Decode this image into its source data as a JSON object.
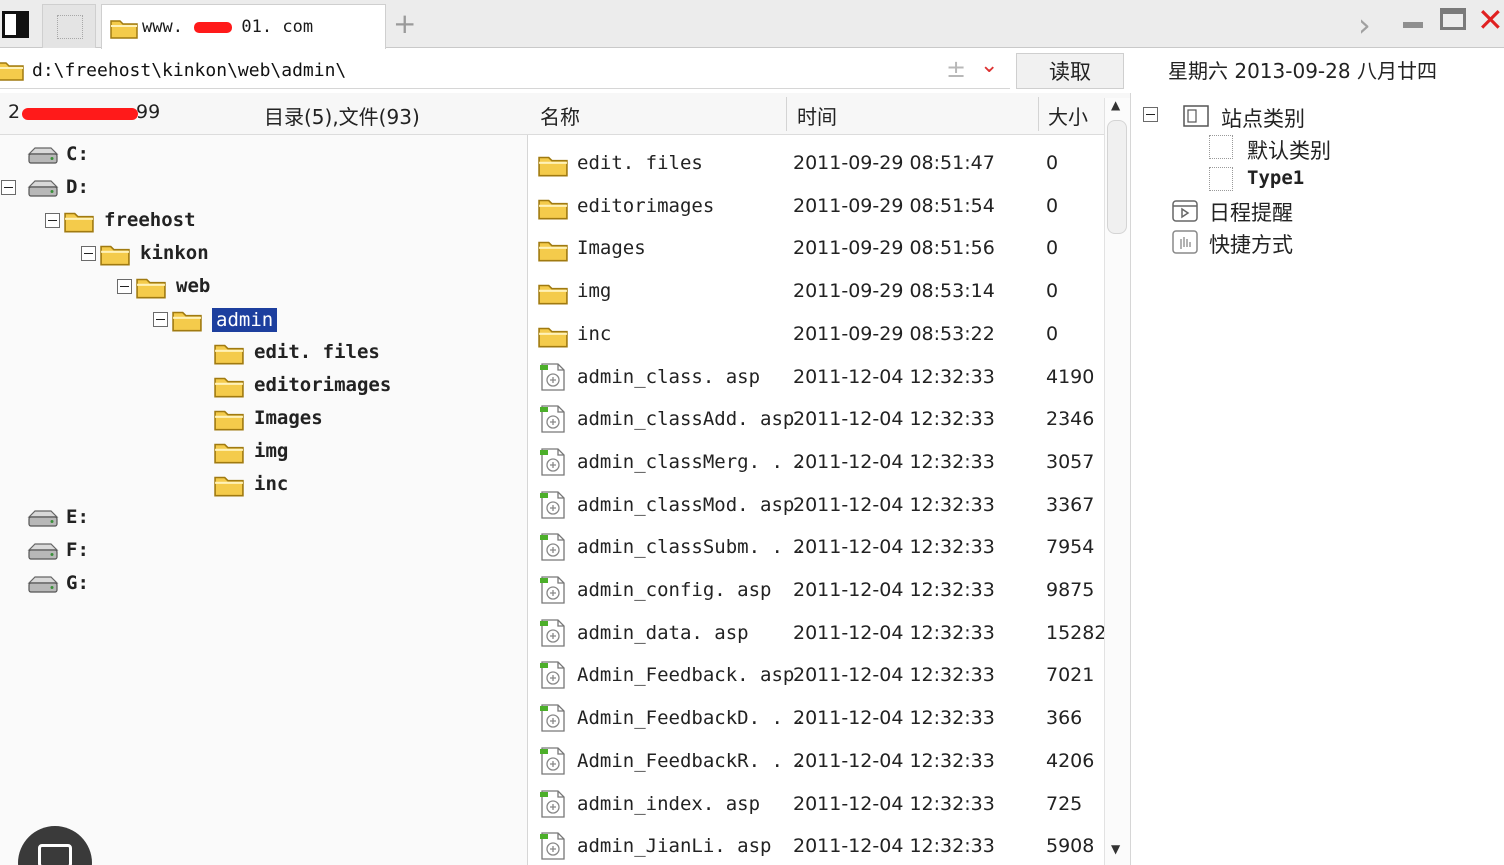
{
  "tabs": {
    "active_label_prefix": "www. c",
    "active_label_suffix": "01. com",
    "add_label": "+"
  },
  "window_controls": {
    "next": "›",
    "close": "✕"
  },
  "address": {
    "path": "d:\\freehost\\kinkon\\web\\admin\\",
    "bookmark": "±",
    "dropdown": "⌄"
  },
  "read_button": "读取",
  "datebar": "星期六 2013-09-28 八月廿四",
  "header": {
    "space_prefix": "2",
    "space_suffix": "99",
    "counts": "目录(5),文件(93)",
    "col_name": "名称",
    "col_time": "时间",
    "col_size": "大小"
  },
  "tree": [
    {
      "label": "C:",
      "type": "drive",
      "depth": 0,
      "expanded": false
    },
    {
      "label": "D:",
      "type": "drive",
      "depth": 0,
      "expanded": true
    },
    {
      "label": "freehost",
      "type": "folder",
      "depth": 1,
      "expanded": true
    },
    {
      "label": "kinkon",
      "type": "folder",
      "depth": 2,
      "expanded": true
    },
    {
      "label": "web",
      "type": "folder",
      "depth": 3,
      "expanded": true
    },
    {
      "label": "admin",
      "type": "folder",
      "depth": 4,
      "expanded": true,
      "selected": true
    },
    {
      "label": "edit. files",
      "type": "folder",
      "depth": 5
    },
    {
      "label": "editorimages",
      "type": "folder",
      "depth": 5
    },
    {
      "label": "Images",
      "type": "folder",
      "depth": 5
    },
    {
      "label": "img",
      "type": "folder",
      "depth": 5
    },
    {
      "label": "inc",
      "type": "folder",
      "depth": 5
    },
    {
      "label": "E:",
      "type": "drive",
      "depth": 0
    },
    {
      "label": "F:",
      "type": "drive",
      "depth": 0
    },
    {
      "label": "G:",
      "type": "drive",
      "depth": 0
    }
  ],
  "files": [
    {
      "name": "edit. files",
      "type": "folder",
      "time": "2011-09-29 08:51:47",
      "size": "0"
    },
    {
      "name": "editorimages",
      "type": "folder",
      "time": "2011-09-29 08:51:54",
      "size": "0"
    },
    {
      "name": "Images",
      "type": "folder",
      "time": "2011-09-29 08:51:56",
      "size": "0"
    },
    {
      "name": "img",
      "type": "folder",
      "time": "2011-09-29 08:53:14",
      "size": "0"
    },
    {
      "name": "inc",
      "type": "folder",
      "time": "2011-09-29 08:53:22",
      "size": "0"
    },
    {
      "name": "admin_class. asp",
      "type": "asp",
      "time": "2011-12-04 12:32:33",
      "size": "4190"
    },
    {
      "name": "admin_classAdd. asp",
      "type": "asp",
      "time": "2011-12-04 12:32:33",
      "size": "2346"
    },
    {
      "name": "admin_classMerg. . .",
      "type": "asp",
      "time": "2011-12-04 12:32:33",
      "size": "3057"
    },
    {
      "name": "admin_classMod. asp",
      "type": "asp",
      "time": "2011-12-04 12:32:33",
      "size": "3367"
    },
    {
      "name": "admin_classSubm. . .",
      "type": "asp",
      "time": "2011-12-04 12:32:33",
      "size": "7954"
    },
    {
      "name": "admin_config. asp",
      "type": "asp",
      "time": "2011-12-04 12:32:33",
      "size": "9875"
    },
    {
      "name": "admin_data. asp",
      "type": "asp",
      "time": "2011-12-04 12:32:33",
      "size": "15282"
    },
    {
      "name": "Admin_Feedback. asp",
      "type": "asp",
      "time": "2011-12-04 12:32:33",
      "size": "7021"
    },
    {
      "name": "Admin_FeedbackD. . .",
      "type": "asp",
      "time": "2011-12-04 12:32:33",
      "size": "366"
    },
    {
      "name": "Admin_FeedbackR. . .",
      "type": "asp",
      "time": "2011-12-04 12:32:33",
      "size": "4206"
    },
    {
      "name": "admin_index. asp",
      "type": "asp",
      "time": "2011-12-04 12:32:33",
      "size": "725"
    },
    {
      "name": "admin_JianLi. asp",
      "type": "asp",
      "time": "2011-12-04 12:32:33",
      "size": "5908"
    }
  ],
  "right_panel": {
    "site_category": "站点类别",
    "default_category": "默认类别",
    "type1": "Type1",
    "schedule": "日程提醒",
    "shortcuts": "快捷方式"
  },
  "colors": {
    "selection": "#1d3f9e",
    "folder": "#f2c23a",
    "redaction": "#ff1a1a",
    "close": "#e02020"
  }
}
